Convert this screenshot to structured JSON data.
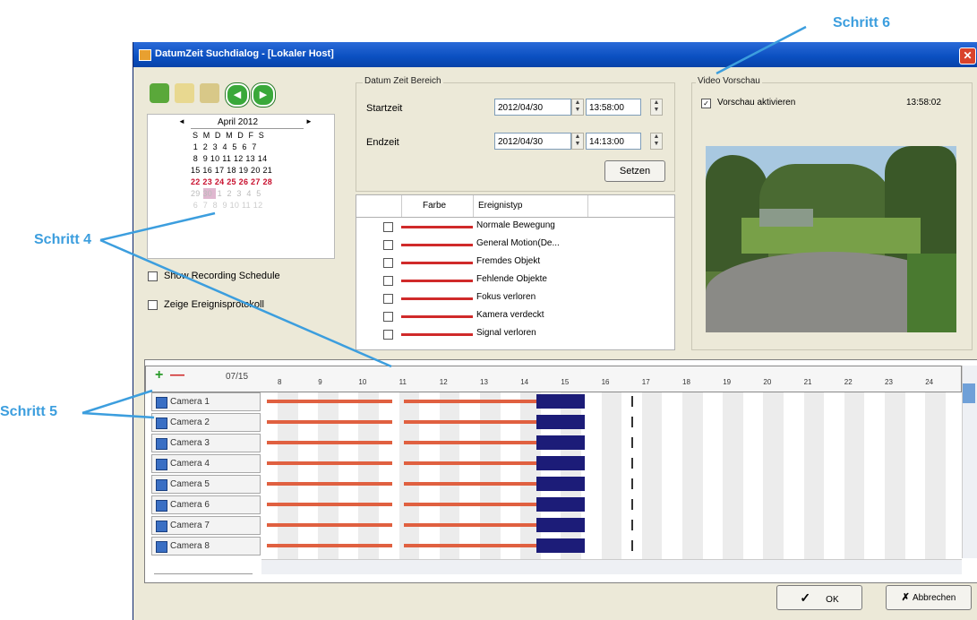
{
  "window": {
    "title": "DatumZeit Suchdialog  -  [Lokaler Host]",
    "close_glyph": "✕"
  },
  "calendar": {
    "prev": "◄",
    "next": "►",
    "month": "April 2012",
    "weekdays": "S M D M D F S",
    "rows": [
      " 1  2  3  4  5  6  7",
      " 8  9 10 11 12 13 14",
      "15 16 17 18 19 20 21",
      "22 23 24 25 26 27 28",
      "29 30  1  2  3  4  5",
      " 6  7  8  9 10 11 12"
    ],
    "selected_day": "30"
  },
  "options": {
    "show_schedule": "Show Recording Schedule",
    "show_log": "Zeige Ereignisprotokoll"
  },
  "datetime_range": {
    "title": "Datum Zeit Bereich",
    "start_label": "Startzeit",
    "start_date": "2012/04/30",
    "start_time": "13:58:00",
    "end_label": "Endzeit",
    "end_date": "2012/04/30",
    "end_time": "14:13:00",
    "set_button": "Setzen"
  },
  "event_table": {
    "col_color": "Farbe",
    "col_type": "Ereignistyp",
    "rows": [
      "Normale Bewegung",
      "General Motion(De...",
      "Fremdes Objekt",
      "Fehlende Objekte",
      "Fokus verloren",
      "Kamera verdeckt",
      "Signal verloren"
    ]
  },
  "video_preview": {
    "title": "Video Vorschau",
    "enable_label": "Vorschau aktivieren",
    "time": "13:58:02"
  },
  "timeline": {
    "date": "07/15",
    "hours": [
      "8",
      "9",
      "10",
      "11",
      "12",
      "13",
      "14",
      "15",
      "16",
      "17",
      "18",
      "19",
      "20",
      "21",
      "22",
      "23",
      "24"
    ],
    "cameras": [
      "Camera 1",
      "Camera 2",
      "Camera 3",
      "Camera 4",
      "Camera 5",
      "Camera 6",
      "Camera 7",
      "Camera 8"
    ]
  },
  "footer": {
    "ok": "OK",
    "cancel": "Abbrechen"
  },
  "annotations": {
    "step4": "Schritt 4",
    "step5": "Schritt 5",
    "step6": "Schritt 6"
  },
  "colors": {
    "annotation": "#3c9ede",
    "titlebar": "#0a4fc0",
    "event_line": "#d02a2a",
    "recording": "#e06040",
    "event_block": "#1c1c78"
  }
}
